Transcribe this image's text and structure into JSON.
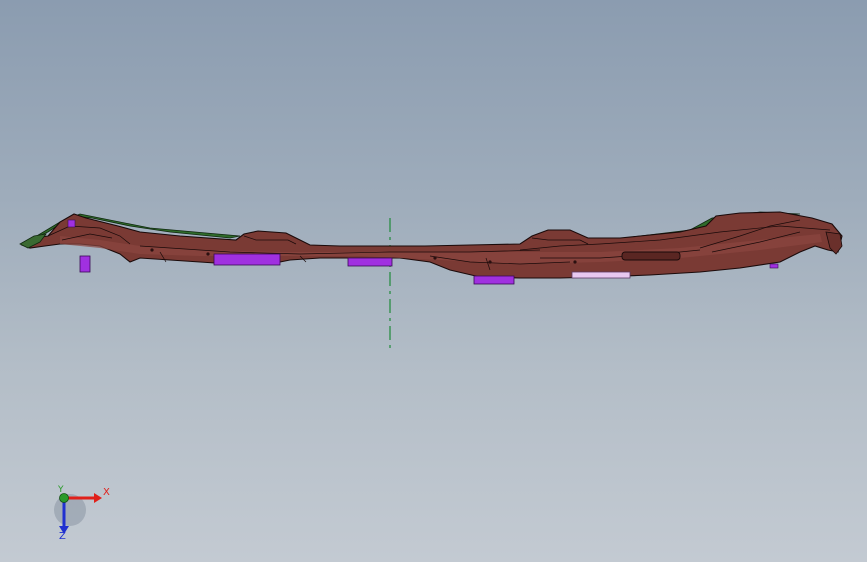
{
  "viewport": {
    "background_top": "#8b9cb0",
    "background_bottom": "#c3cad2"
  },
  "model": {
    "body_color": "#7a3a34",
    "edge_color": "#1a0a0a",
    "top_surface_color": "#2f6b2a",
    "clip_color": "#a030e0",
    "clip_light_color": "#e8c8f0",
    "center_axis_color": "#1f8a3a"
  },
  "triad": {
    "x_label": "X",
    "y_label": "Y",
    "z_label": "Z",
    "x_color": "#e0201a",
    "y_color": "#2a9a2a",
    "z_color": "#2030d0"
  }
}
